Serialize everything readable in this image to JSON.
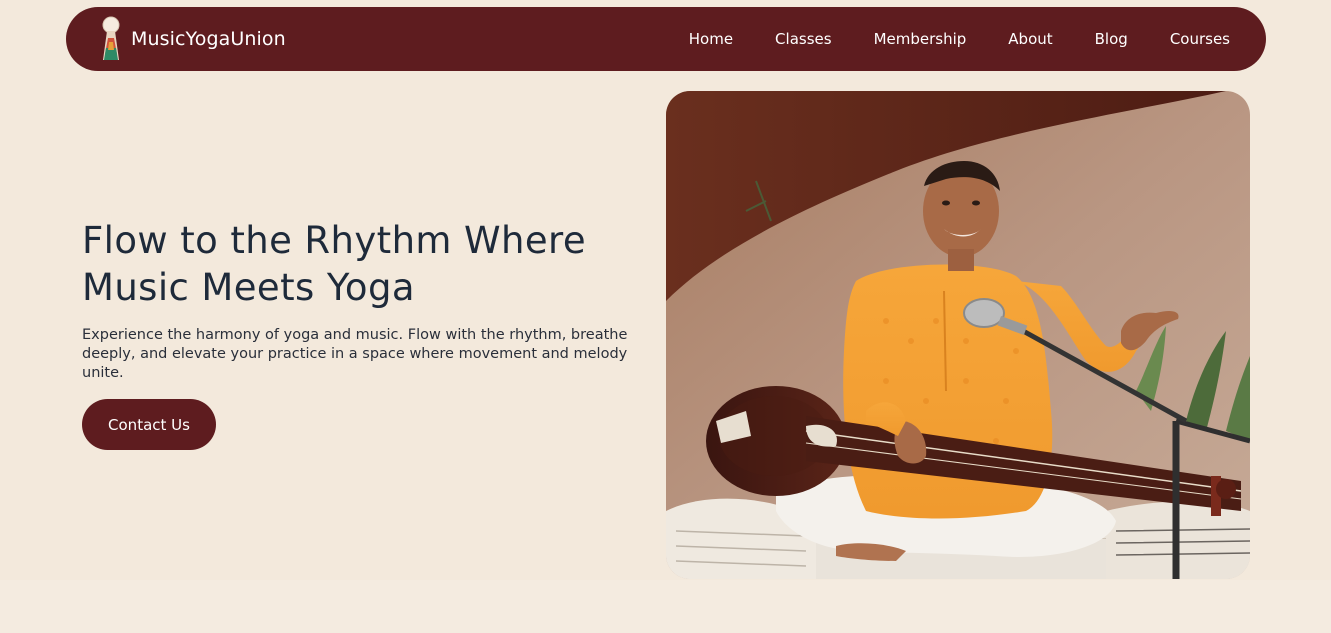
{
  "brand": {
    "name": "MusicYogaUnion",
    "logo_icon": "keyhole-figure-logo"
  },
  "nav": {
    "items": [
      {
        "label": "Home"
      },
      {
        "label": "Classes"
      },
      {
        "label": "Membership"
      },
      {
        "label": "About"
      },
      {
        "label": "Blog"
      },
      {
        "label": "Courses"
      }
    ]
  },
  "hero": {
    "title": "Flow to the Rhythm Where Music Meets Yoga",
    "description": "Experience the harmony of yoga and music. Flow with the rhythm, breathe deeply, and elevate your practice in a space where movement and melody unite.",
    "cta_label": "Contact Us"
  },
  "colors": {
    "primary": "#5e1c1f",
    "background": "#f3e9dc",
    "heading": "#1e2a3a",
    "nav_text": "#ffffff"
  }
}
